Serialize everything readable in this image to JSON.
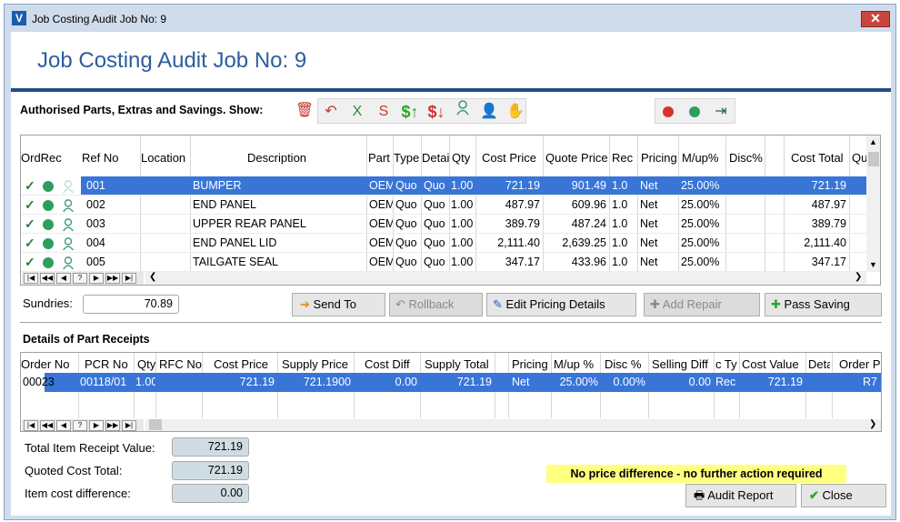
{
  "window": {
    "title": "Job Costing Audit Job No: 9",
    "close_glyph": "✕"
  },
  "header": {
    "title": "Job Costing Audit Job No: 9"
  },
  "parts_section": {
    "label": "Authorised Parts, Extras and Savings. Show:",
    "toolbar": {
      "delete_icon": "🗑",
      "undo_icon": "↶",
      "x_label": "X",
      "s_label": "S",
      "dollar_up": "$↑",
      "dollar_down": "$↓",
      "person_icon": "👤",
      "hand_icon": "✋",
      "export_icon": "⇥"
    },
    "columns": [
      "OrdRec",
      "Ref No",
      "Location",
      "Description",
      "Part",
      "Type",
      "Detai",
      "Qty",
      "Cost Price",
      "Quote Price",
      "Rec",
      "Pricing",
      "M/up%",
      "Disc%",
      "",
      "Cost Total",
      "Qu"
    ],
    "rows": [
      {
        "ref": "001",
        "location": "",
        "desc": "BUMPER",
        "part": "OEM",
        "type": "Quo",
        "detail": "Quo",
        "qty": "1.00",
        "cost": "721.19",
        "quote": "901.49",
        "rec": "1.0",
        "pricing": "Net",
        "mup": "25.00%",
        "disc": "",
        "total": "721.19"
      },
      {
        "ref": "002",
        "location": "",
        "desc": "END PANEL",
        "part": "OEM",
        "type": "Quo",
        "detail": "Quo",
        "qty": "1.00",
        "cost": "487.97",
        "quote": "609.96",
        "rec": "1.0",
        "pricing": "Net",
        "mup": "25.00%",
        "disc": "",
        "total": "487.97"
      },
      {
        "ref": "003",
        "location": "",
        "desc": "UPPER REAR PANEL",
        "part": "OEM",
        "type": "Quo",
        "detail": "Quo",
        "qty": "1.00",
        "cost": "389.79",
        "quote": "487.24",
        "rec": "1.0",
        "pricing": "Net",
        "mup": "25.00%",
        "disc": "",
        "total": "389.79"
      },
      {
        "ref": "004",
        "location": "",
        "desc": "END PANEL LID",
        "part": "OEM",
        "type": "Quo",
        "detail": "Quo",
        "qty": "1.00",
        "cost": "2,111.40",
        "quote": "2,639.25",
        "rec": "1.0",
        "pricing": "Net",
        "mup": "25.00%",
        "disc": "",
        "total": "2,111.40"
      },
      {
        "ref": "005",
        "location": "",
        "desc": "TAILGATE SEAL",
        "part": "OEM",
        "type": "Quo",
        "detail": "Quo",
        "qty": "1.00",
        "cost": "347.17",
        "quote": "433.96",
        "rec": "1.0",
        "pricing": "Net",
        "mup": "25.00%",
        "disc": "",
        "total": "347.17"
      }
    ],
    "nav": [
      "|◀",
      "◀◀",
      "◀",
      "?",
      "▶",
      "▶▶",
      "▶|"
    ]
  },
  "sundries": {
    "label": "Sundries:",
    "value": "70.89"
  },
  "actions": {
    "send_to": "Send To",
    "rollback": "Rollback",
    "edit_pricing": "Edit Pricing Details",
    "add_repair": "Add Repair",
    "pass_saving": "Pass Saving"
  },
  "receipts_section": {
    "label": "Details of Part Receipts",
    "columns": [
      "Order No",
      "PCR No",
      "Qty",
      "RFC No",
      "Cost Price",
      "Supply Price",
      "Cost Diff",
      "Supply Total",
      "",
      "Pricing",
      "M/up %",
      "Disc %",
      "Selling Diff",
      "c Ty",
      "Cost Value",
      "Deta",
      "Order P"
    ],
    "rows": [
      {
        "order": "00023",
        "pcr": "00118/01",
        "qty": "1.00",
        "rfc": "",
        "cost": "721.19",
        "supply": "721.1900",
        "diff": "0.00",
        "supply_total": "721.19",
        "pricing": "Net",
        "mup": "25.00%",
        "disc": "0.00%",
        "sell_diff": "0.00",
        "ctype": "Rec",
        "cost_value": "721.19",
        "detail": "",
        "order_p": "R7"
      }
    ]
  },
  "totals": {
    "receipt_label": "Total Item Receipt Value:",
    "receipt_value": "721.19",
    "quoted_label": "Quoted Cost Total:",
    "quoted_value": "721.19",
    "diff_label": "Item cost difference:",
    "diff_value": "0.00"
  },
  "notice": "No price difference - no further action required",
  "footer": {
    "audit_report": "Audit Report",
    "close": "Close"
  },
  "colors": {
    "accent": "#2d5d9f",
    "selection": "#3875d7",
    "notice_bg": "#ffff80"
  }
}
